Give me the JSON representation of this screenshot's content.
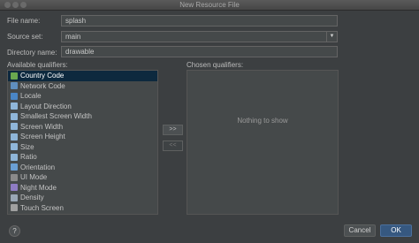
{
  "window": {
    "title": "New Resource File"
  },
  "form": {
    "file_name_label": "File name:",
    "file_name_value": "splash",
    "source_set_label": "Source set:",
    "source_set_value": "main",
    "directory_label": "Directory name:",
    "directory_value": "drawable"
  },
  "qualifiers": {
    "available_label": "Available qualifiers:",
    "chosen_label": "Chosen qualifiers:",
    "empty_text": "Nothing to show",
    "add_label": ">>",
    "remove_label": "<<",
    "items": [
      {
        "label": "Country Code",
        "icon": "globe-icon",
        "color": "#6aa84f",
        "selected": true
      },
      {
        "label": "Network Code",
        "icon": "network-icon",
        "color": "#5f8fbf"
      },
      {
        "label": "Locale",
        "icon": "locale-icon",
        "color": "#4a86c5"
      },
      {
        "label": "Layout Direction",
        "icon": "layout-direction-icon",
        "color": "#8fb6d9"
      },
      {
        "label": "Smallest Screen Width",
        "icon": "screen-width-icon",
        "color": "#8fb6d9"
      },
      {
        "label": "Screen Width",
        "icon": "screen-width-icon",
        "color": "#8fb6d9"
      },
      {
        "label": "Screen Height",
        "icon": "screen-height-icon",
        "color": "#8fb6d9"
      },
      {
        "label": "Size",
        "icon": "size-icon",
        "color": "#8fb6d9"
      },
      {
        "label": "Ratio",
        "icon": "ratio-icon",
        "color": "#8fb6d9"
      },
      {
        "label": "Orientation",
        "icon": "orientation-icon",
        "color": "#6a9fd4"
      },
      {
        "label": "UI Mode",
        "icon": "ui-mode-icon",
        "color": "#8a8a8a"
      },
      {
        "label": "Night Mode",
        "icon": "night-mode-icon",
        "color": "#8e7cc3"
      },
      {
        "label": "Density",
        "icon": "density-icon",
        "color": "#9aa7b5"
      },
      {
        "label": "Touch Screen",
        "icon": "touch-screen-icon",
        "color": "#a0a0a0"
      }
    ]
  },
  "footer": {
    "help_label": "?",
    "cancel_label": "Cancel",
    "ok_label": "OK"
  }
}
